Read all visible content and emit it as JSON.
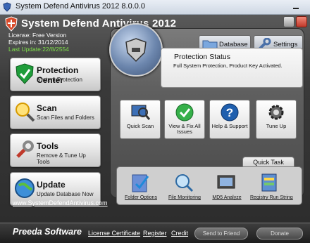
{
  "window": {
    "title": "System Defend Antivirus 2012 8.0.0.0"
  },
  "app": {
    "name": "System Defend Antivirus 2012"
  },
  "license": {
    "version": "License: Free Version",
    "expires": "Expires in: 31/12/2014",
    "last_update": "Last Update:22/8/2554"
  },
  "nav": [
    {
      "title": "Protection Center",
      "sub": "System Protection",
      "icon": "check-shield-icon"
    },
    {
      "title": "Scan",
      "sub": "Scan Files and Folders",
      "icon": "magnifier-icon"
    },
    {
      "title": "Tools",
      "sub": "Remove & Tune Up Tools",
      "icon": "wrench-icon"
    },
    {
      "title": "Update",
      "sub": "Update Database Now",
      "icon": "globe-icon"
    }
  ],
  "website": "www.SystemDefendAntivirus.com",
  "top_buttons": {
    "database": "Database",
    "settings": "Settings"
  },
  "status": {
    "heading": "Protection Status",
    "detail": "Full System Protection, Product Key Activated."
  },
  "actions": [
    {
      "label": "Quick Scan",
      "icon": "scan-monitor-icon"
    },
    {
      "label": "View & Fix All Issues",
      "icon": "check-circle-icon"
    },
    {
      "label": "Help & Support",
      "icon": "question-icon"
    },
    {
      "label": "Tune Up",
      "icon": "gear-icon"
    }
  ],
  "quick_task": {
    "tab": "Quick Task",
    "items": [
      {
        "label": "Folder Options",
        "icon": "folder-check-icon"
      },
      {
        "label": "File Monitoring",
        "icon": "monitor-magnifier-icon"
      },
      {
        "label": "MD5 Analyze",
        "icon": "md5-icon"
      },
      {
        "label": "Registry Run String",
        "icon": "registry-icon"
      }
    ]
  },
  "footer": {
    "brand": "Preeda Software",
    "links": [
      "License Certificate",
      "Register",
      "Credit"
    ],
    "send_to_friend": "Send to Friend",
    "donate": "Donate"
  },
  "colors": {
    "accent_green": "#7fe14a",
    "panel_dark": "#2b2b2b"
  }
}
